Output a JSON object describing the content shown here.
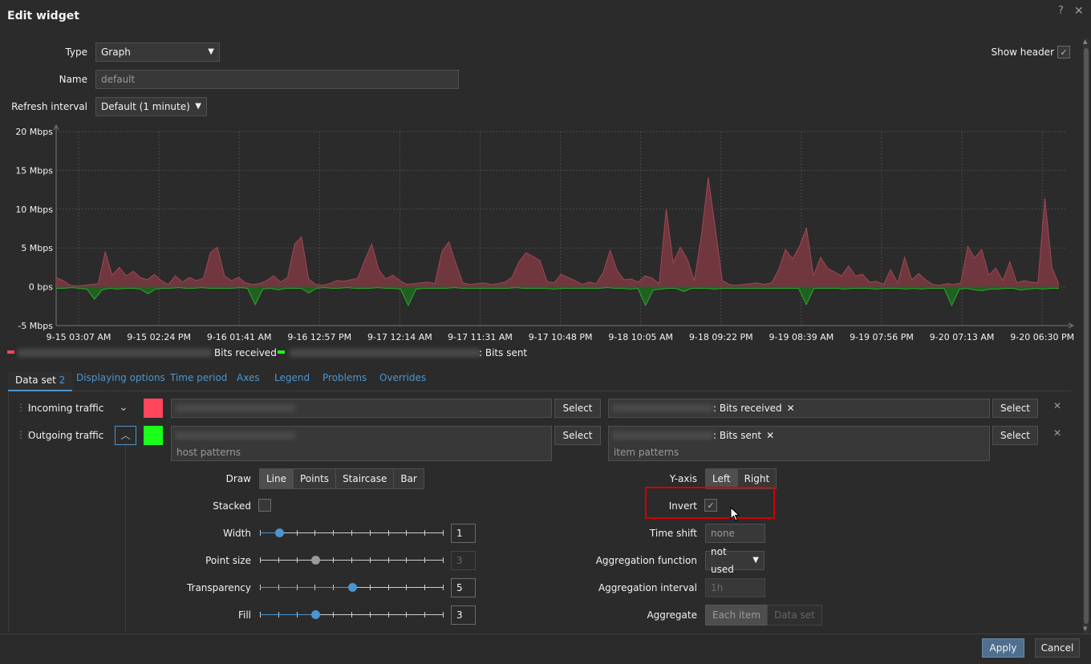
{
  "dialog": {
    "title": "Edit widget",
    "help_icon": "?",
    "close_icon": "✕"
  },
  "form": {
    "type_label": "Type",
    "type_value": "Graph",
    "name_label": "Name",
    "name_placeholder": "default",
    "refresh_label": "Refresh interval",
    "refresh_value": "Default (1 minute)",
    "show_header_label": "Show header",
    "show_header_checked": true
  },
  "colors": {
    "received": "#ff465c",
    "sent": "#1aff1a",
    "accent": "#4b95d0",
    "highlight_box": "#d40000"
  },
  "chart_data": {
    "type": "area",
    "y_ticks": [
      "20 Mbps",
      "15 Mbps",
      "10 Mbps",
      "5 Mbps",
      "0 bps",
      "-5 Mbps"
    ],
    "ylim": [
      -5,
      20
    ],
    "x_ticks": [
      "9-15 03:07 AM",
      "9-15 02:24 PM",
      "9-16 01:41 AM",
      "9-16 12:57 PM",
      "9-17 12:14 AM",
      "9-17 11:31 AM",
      "9-17 10:48 PM",
      "9-18 10:05 AM",
      "9-18 09:22 PM",
      "9-19 08:39 AM",
      "9-19 07:56 PM",
      "9-20 07:13 AM",
      "9-20 06:30 PM"
    ],
    "grid": true,
    "legend_position": "bottom-left",
    "series": [
      {
        "name": "Bits received",
        "color": "#ff465c",
        "values": [
          1.2,
          0.8,
          0.2,
          0.1,
          0.2,
          0.3,
          0.4,
          4.5,
          1.5,
          2.5,
          1.4,
          2,
          1.2,
          0.9,
          1.6,
          0.8,
          0.3,
          1.4,
          0.6,
          1.2,
          0.8,
          1.1,
          4.4,
          5.1,
          1.4,
          0.8,
          1.2,
          0.5,
          0.3,
          0.4,
          0.8,
          1.4,
          0.6,
          1.2,
          5.5,
          6.4,
          1,
          0.3,
          0.2,
          0.4,
          0.8,
          0.7,
          0.9,
          1.1,
          3.4,
          5.5,
          2.2,
          1,
          1.5,
          0.8,
          0.3,
          0.4,
          0.5,
          0.6,
          0.4,
          4.5,
          5.8,
          3,
          0.5,
          0.3,
          0.4,
          0.5,
          0.3,
          0.4,
          0.6,
          1.2,
          3.2,
          4.4,
          3.9,
          3.4,
          0.7,
          0.5,
          1.6,
          1.2,
          0.8,
          0.3,
          0.6,
          0.4,
          1.8,
          4.7,
          2.1,
          0.9,
          1,
          0.6,
          1.4,
          1.1,
          0.4,
          10,
          3.1,
          5.1,
          3.6,
          0.8,
          6.5,
          14.1,
          7.5,
          0.8,
          0.3,
          0.2,
          0.3,
          0.4,
          0.5,
          0.3,
          0.5,
          2.1,
          4.8,
          3.6,
          5.2,
          7.6,
          1.4,
          3.8,
          2.4,
          1.9,
          1.4,
          2.7,
          1.4,
          1.6,
          0.6,
          0.7,
          0.3,
          2.2,
          0.5,
          3.8,
          0.9,
          1.7,
          0.9,
          0.3,
          0.2,
          0.4,
          0.3,
          0.5,
          5.2,
          3.7,
          4.8,
          1.5,
          2.4,
          0.8,
          3.2,
          0.5,
          0.8,
          0.6,
          0.5,
          11.4,
          2.5,
          0.3
        ]
      },
      {
        "name": "Bits sent",
        "color": "#1aff1a",
        "values": [
          -0.2,
          -0.2,
          -0.1,
          -0.2,
          -0.3,
          -1.6,
          -0.4,
          -0.2,
          -0.3,
          -0.2,
          -0.2,
          -0.3,
          -0.9,
          -0.3,
          -0.2,
          -0.2,
          -0.1,
          -0.2,
          -0.2,
          -0.1,
          -0.2,
          -0.2,
          -0.2,
          -0.2,
          -0.1,
          -0.2,
          -2.3,
          -0.3,
          -0.2,
          -0.4,
          -0.2,
          -0.2,
          -0.2,
          -0.8,
          -0.2,
          -0.1,
          -0.2,
          -0.2,
          -0.1,
          -0.2,
          -0.2,
          -0.2,
          -0.1,
          -0.2,
          -0.2,
          -0.3,
          -2.4,
          -0.3,
          -0.2,
          -0.2,
          -0.2,
          -0.2,
          -0.1,
          -0.2,
          -0.2,
          -0.2,
          -0.2,
          -0.2,
          -0.2,
          -0.2,
          -0.1,
          -0.2,
          -0.2,
          -0.2,
          -0.2,
          -0.3,
          -0.2,
          -0.2,
          -0.2,
          -0.2,
          -0.2,
          -0.2,
          -0.1,
          -0.2,
          -0.2,
          -0.3,
          -0.2,
          -2.4,
          -0.4,
          -0.3,
          -0.2,
          -0.2,
          -0.6,
          -0.2,
          -0.2,
          -0.2,
          -0.3,
          -0.2,
          -0.2,
          -0.2,
          -0.2,
          -0.2,
          -0.2,
          -0.2,
          -0.2,
          -0.2,
          -0.2,
          -0.2,
          -2.3,
          -0.2,
          -0.2,
          -0.2,
          -0.2,
          -0.3,
          -0.2,
          -0.2,
          -0.2,
          -0.3,
          -0.2,
          -0.2,
          -0.2,
          -0.3,
          -0.2,
          -0.3,
          -0.2,
          -0.2,
          -0.2,
          -2.4,
          -0.3,
          -0.2,
          -0.4,
          -0.5,
          -0.3,
          -0.3,
          -0.2,
          -0.2,
          -0.4,
          -0.3,
          -0.2,
          -0.3,
          -0.2,
          -0.2
        ]
      }
    ]
  },
  "tabs": [
    {
      "label": "Data set",
      "count": "2"
    },
    {
      "label": "Displaying options"
    },
    {
      "label": "Time period"
    },
    {
      "label": "Axes"
    },
    {
      "label": "Legend"
    },
    {
      "label": "Problems"
    },
    {
      "label": "Overrides"
    }
  ],
  "datasets": [
    {
      "name": "Incoming traffic",
      "color": "#ff465c",
      "item_tag": ": Bits received",
      "select_label": "Select"
    },
    {
      "name": "Outgoing traffic",
      "color": "#1aff1a",
      "item_tag": ": Bits sent",
      "select_label": "Select",
      "host_placeholder": "host patterns",
      "item_placeholder": "item patterns"
    }
  ],
  "options": {
    "draw_label": "Draw",
    "draw_options": [
      "Line",
      "Points",
      "Staircase",
      "Bar"
    ],
    "draw_selected": "Line",
    "stacked_label": "Stacked",
    "width_label": "Width",
    "width_value": "1",
    "width_level": 1,
    "point_size_label": "Point size",
    "point_size_value": "3",
    "point_size_level": 3,
    "transparency_label": "Transparency",
    "transparency_value": "5",
    "transparency_level": 5,
    "fill_label": "Fill",
    "fill_value": "3",
    "fill_level": 3,
    "yaxis_label": "Y-axis",
    "yaxis_options": [
      "Left",
      "Right"
    ],
    "yaxis_selected": "Left",
    "invert_label": "Invert",
    "invert_checked": true,
    "time_shift_label": "Time shift",
    "time_shift_placeholder": "none",
    "agg_function_label": "Aggregation function",
    "agg_function_value": "not used",
    "agg_interval_label": "Aggregation interval",
    "agg_interval_placeholder": "1h",
    "aggregate_label": "Aggregate",
    "aggregate_options": [
      "Each item",
      "Data set"
    ]
  },
  "footer": {
    "apply_label": "Apply",
    "cancel_label": "Cancel"
  }
}
